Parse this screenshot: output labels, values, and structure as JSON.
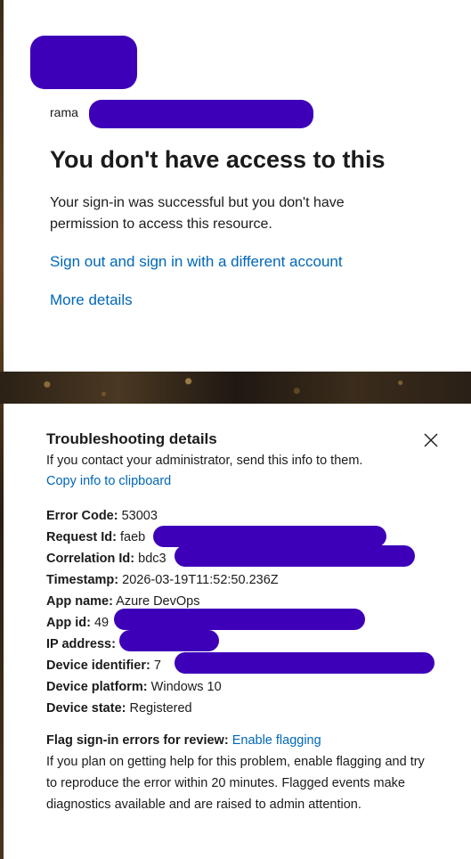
{
  "header": {
    "username_prefix": "rama"
  },
  "main": {
    "title": "You don't have access to this",
    "message": "Your sign-in was successful but you don't have permission to access this resource.",
    "signout_link": "Sign out and sign in with a different account",
    "more_details_link": "More details"
  },
  "troubleshooting": {
    "title": "Troubleshooting details",
    "description": "If you contact your administrator, send this info to them.",
    "copy_link": "Copy info to clipboard",
    "details": [
      {
        "label": "Error Code:",
        "value": "53003"
      },
      {
        "label": "Request Id:",
        "value": "faeb"
      },
      {
        "label": "Correlation Id:",
        "value": "bdc3"
      },
      {
        "label": "Timestamp:",
        "value": "2026-03-19T11:52:50.236Z"
      },
      {
        "label": "App name:",
        "value": "Azure DevOps"
      },
      {
        "label": "App id:",
        "value": "49"
      },
      {
        "label": "IP address:",
        "value": ""
      },
      {
        "label": "Device identifier:",
        "value": "7"
      },
      {
        "label": "Device platform:",
        "value": "Windows 10"
      },
      {
        "label": "Device state:",
        "value": "Registered"
      }
    ],
    "flag_label": "Flag sign-in errors for review:",
    "flag_link": "Enable flagging",
    "flag_text": "If you plan on getting help for this problem, enable flagging and try to reproduce the error within 20 minutes. Flagged events make diagnostics available and are raised to admin attention."
  },
  "colors": {
    "link": "#0067b8",
    "redaction": "#3d00b8",
    "text": "#1b1b1b"
  },
  "icons": {
    "close": "close-icon"
  }
}
